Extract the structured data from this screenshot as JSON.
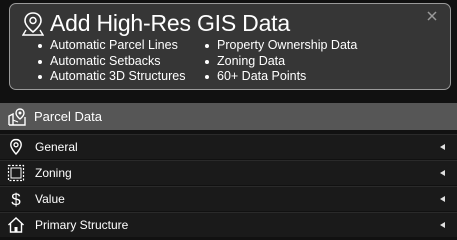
{
  "promo": {
    "title": "Add High-Res GIS Data",
    "features_left": [
      "Automatic Parcel Lines",
      "Automatic Setbacks",
      "Automatic 3D Structures"
    ],
    "features_right": [
      "Property Ownership Data",
      "Zoning Data",
      "60+ Data Points"
    ],
    "icons": {
      "title": "map-pin-icon",
      "close": "close-icon"
    }
  },
  "section": {
    "label": "Parcel Data",
    "icon": "parcel-map-icon"
  },
  "rows": [
    {
      "label": "General",
      "icon": "location-pin-icon"
    },
    {
      "label": "Zoning",
      "icon": "zoning-grid-icon"
    },
    {
      "label": "Value",
      "icon": "dollar-icon"
    },
    {
      "label": "Primary Structure",
      "icon": "house-icon"
    }
  ],
  "colors": {
    "background": "#111111",
    "promo_bg": "#363636",
    "header_bg": "#565656",
    "row_bg": "#1a1a1a"
  }
}
